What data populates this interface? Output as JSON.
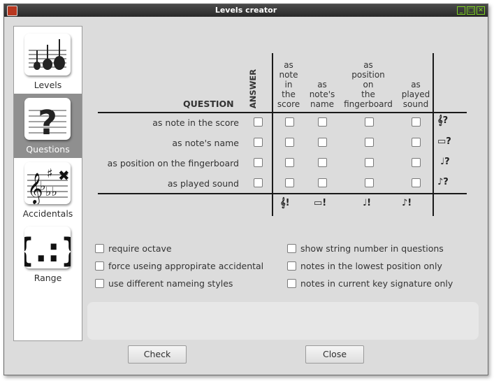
{
  "window": {
    "title": "Levels creator"
  },
  "sidebar": {
    "items": [
      {
        "label": "Levels",
        "icon": "guitars-on-staff-icon"
      },
      {
        "label": "Questions",
        "icon": "question-mark-on-staff-icon"
      },
      {
        "label": "Accidentals",
        "icon": "accidentals-on-staff-icon"
      },
      {
        "label": "Range",
        "icon": "curly-braces-range-icon"
      }
    ]
  },
  "questions": {
    "header_question": "QUESTION",
    "header_answer": "ANSWER",
    "columns": [
      [
        "as",
        "note",
        "in",
        "the",
        "score"
      ],
      [
        "as",
        "note's",
        "name"
      ],
      [
        "as",
        "position",
        "on",
        "the",
        "fingerboard"
      ],
      [
        "as",
        "played",
        "sound"
      ]
    ],
    "rows": [
      "as note in the score",
      "as note's name",
      "as position on the fingerboard",
      "as played sound"
    ],
    "row_icons": [
      "𝄞?",
      "▭?",
      "♩?",
      "♪?"
    ],
    "answer_icons": [
      "𝄞!",
      "▭!",
      "♩!",
      "♪!"
    ]
  },
  "options": {
    "left": [
      "require octave",
      "force useing appropirate accidental",
      "use different nameing styles"
    ],
    "right": [
      "show string number in questions",
      "notes in the lowest position only",
      "notes in current key signature only"
    ]
  },
  "buttons": {
    "check": "Check",
    "close": "Close"
  }
}
